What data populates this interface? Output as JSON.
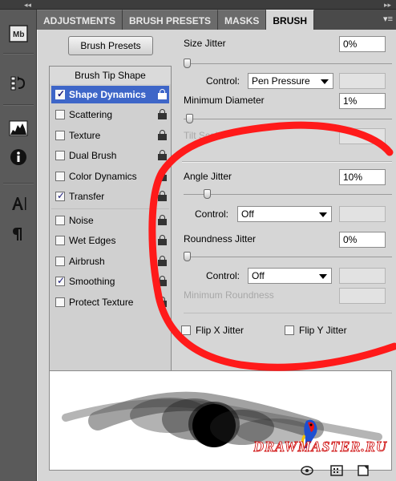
{
  "tabs": [
    {
      "label": "ADJUSTMENTS",
      "active": false
    },
    {
      "label": "BRUSH PRESETS",
      "active": false
    },
    {
      "label": "MASKS",
      "active": false
    },
    {
      "label": "BRUSH",
      "active": true
    }
  ],
  "dock": {
    "collapse_glyph": "◂◂",
    "icons": [
      "mini-bridge-icon",
      "history-icon",
      "histogram-icon",
      "info-icon",
      "character-icon",
      "paragraph-icon"
    ],
    "mb_text": "Mb"
  },
  "topbar": {
    "collapse_glyph": "▸▸"
  },
  "panel_menu_glyph": "▾≡",
  "brush_presets_button": "Brush Presets",
  "options_list": {
    "header": "Brush Tip Shape",
    "items": [
      {
        "label": "Shape Dynamics",
        "checked": true,
        "selected": true
      },
      {
        "label": "Scattering",
        "checked": false,
        "selected": false
      },
      {
        "label": "Texture",
        "checked": false,
        "selected": false
      },
      {
        "label": "Dual Brush",
        "checked": false,
        "selected": false
      },
      {
        "label": "Color Dynamics",
        "checked": false,
        "selected": false
      },
      {
        "label": "Transfer",
        "checked": true,
        "selected": false
      },
      {
        "label": "Noise",
        "checked": false,
        "selected": false
      },
      {
        "label": "Wet Edges",
        "checked": false,
        "selected": false
      },
      {
        "label": "Airbrush",
        "checked": false,
        "selected": false
      },
      {
        "label": "Smoothing",
        "checked": true,
        "selected": false
      },
      {
        "label": "Protect Texture",
        "checked": false,
        "selected": false
      }
    ]
  },
  "settings": {
    "size_jitter": {
      "label": "Size Jitter",
      "value": "0%",
      "slider": 0
    },
    "size_control": {
      "label": "Control:",
      "value": "Pen Pressure"
    },
    "min_diameter": {
      "label": "Minimum Diameter",
      "value": "1%",
      "slider": 0.01
    },
    "tilt_scale": {
      "label": "Tilt Scale"
    },
    "angle_jitter": {
      "label": "Angle Jitter",
      "value": "10%",
      "slider": 0.1
    },
    "angle_control": {
      "label": "Control:",
      "value": "Off"
    },
    "roundness_jitter": {
      "label": "Roundness Jitter",
      "value": "0%",
      "slider": 0
    },
    "roundness_control": {
      "label": "Control:",
      "value": "Off"
    },
    "min_roundness": {
      "label": "Minimum Roundness"
    },
    "flip_x": {
      "label": "Flip X Jitter",
      "checked": false
    },
    "flip_y": {
      "label": "Flip Y Jitter",
      "checked": false
    }
  },
  "watermark": {
    "text": "DRAWMASTER.RU"
  },
  "colors": {
    "accent": "#3e66c8",
    "annotation": "#ff1a1a",
    "panel_bg": "#d6d6d6",
    "tab_bg": "#6b6b6b"
  }
}
